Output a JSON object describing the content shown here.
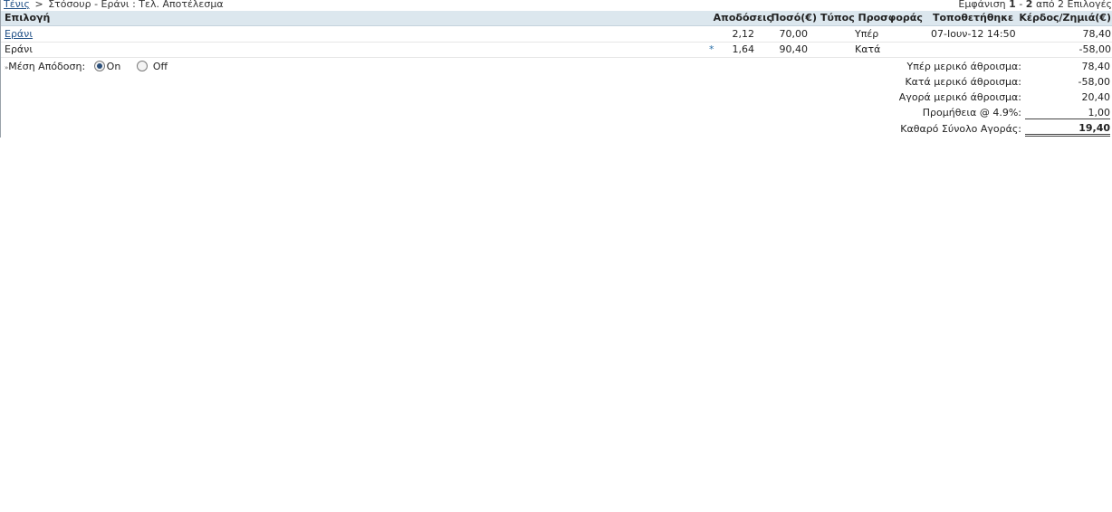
{
  "breadcrumb": {
    "link": "Τένις",
    "separator": ">",
    "rest": "Στόσουρ - Εράνι : Τελ. Αποτέλεσμα"
  },
  "paging": {
    "prefix": "Εμφάνιση",
    "start": "1",
    "dash": "-",
    "end": "2",
    "suffix": "από 2 Επιλογές"
  },
  "table": {
    "headers": {
      "selection": "Επιλογή",
      "odds": "Αποδόσεις",
      "amount": "Ποσό(€)",
      "offer_type": "Τύπος Προσφοράς",
      "placed": "Τοποθετήθηκε",
      "profit_loss": "Κέρδος/Ζημιά(€)"
    },
    "rows": [
      {
        "selection": "Εράνι",
        "marker": "",
        "odds": "2,12",
        "amount": "70,00",
        "offer_type": "Υπέρ",
        "placed": "07-Ιουν-12 14:50",
        "profit_loss": "78,40"
      },
      {
        "selection": "Εράνι",
        "marker": "*",
        "odds": "1,64",
        "amount": "90,40",
        "offer_type": "Κατά",
        "placed": "",
        "profit_loss": "-58,00"
      }
    ]
  },
  "average_odds": {
    "marker": "»",
    "label": "Μέση Απόδοση:",
    "on_label": "On",
    "off_label": "Off",
    "selected": "On"
  },
  "summary": [
    {
      "label": "Υπέρ μερικό άθροισμα:",
      "value": "78,40"
    },
    {
      "label": "Κατά μερικό άθροισμα:",
      "value": "-58,00"
    },
    {
      "label": "Αγορά μερικό άθροισμα:",
      "value": "20,40"
    },
    {
      "label": "Προμήθεια @ 4.9%:",
      "value": "1,00"
    },
    {
      "label": "Καθαρό Σύνολο Αγοράς:",
      "value": "19,40"
    }
  ]
}
